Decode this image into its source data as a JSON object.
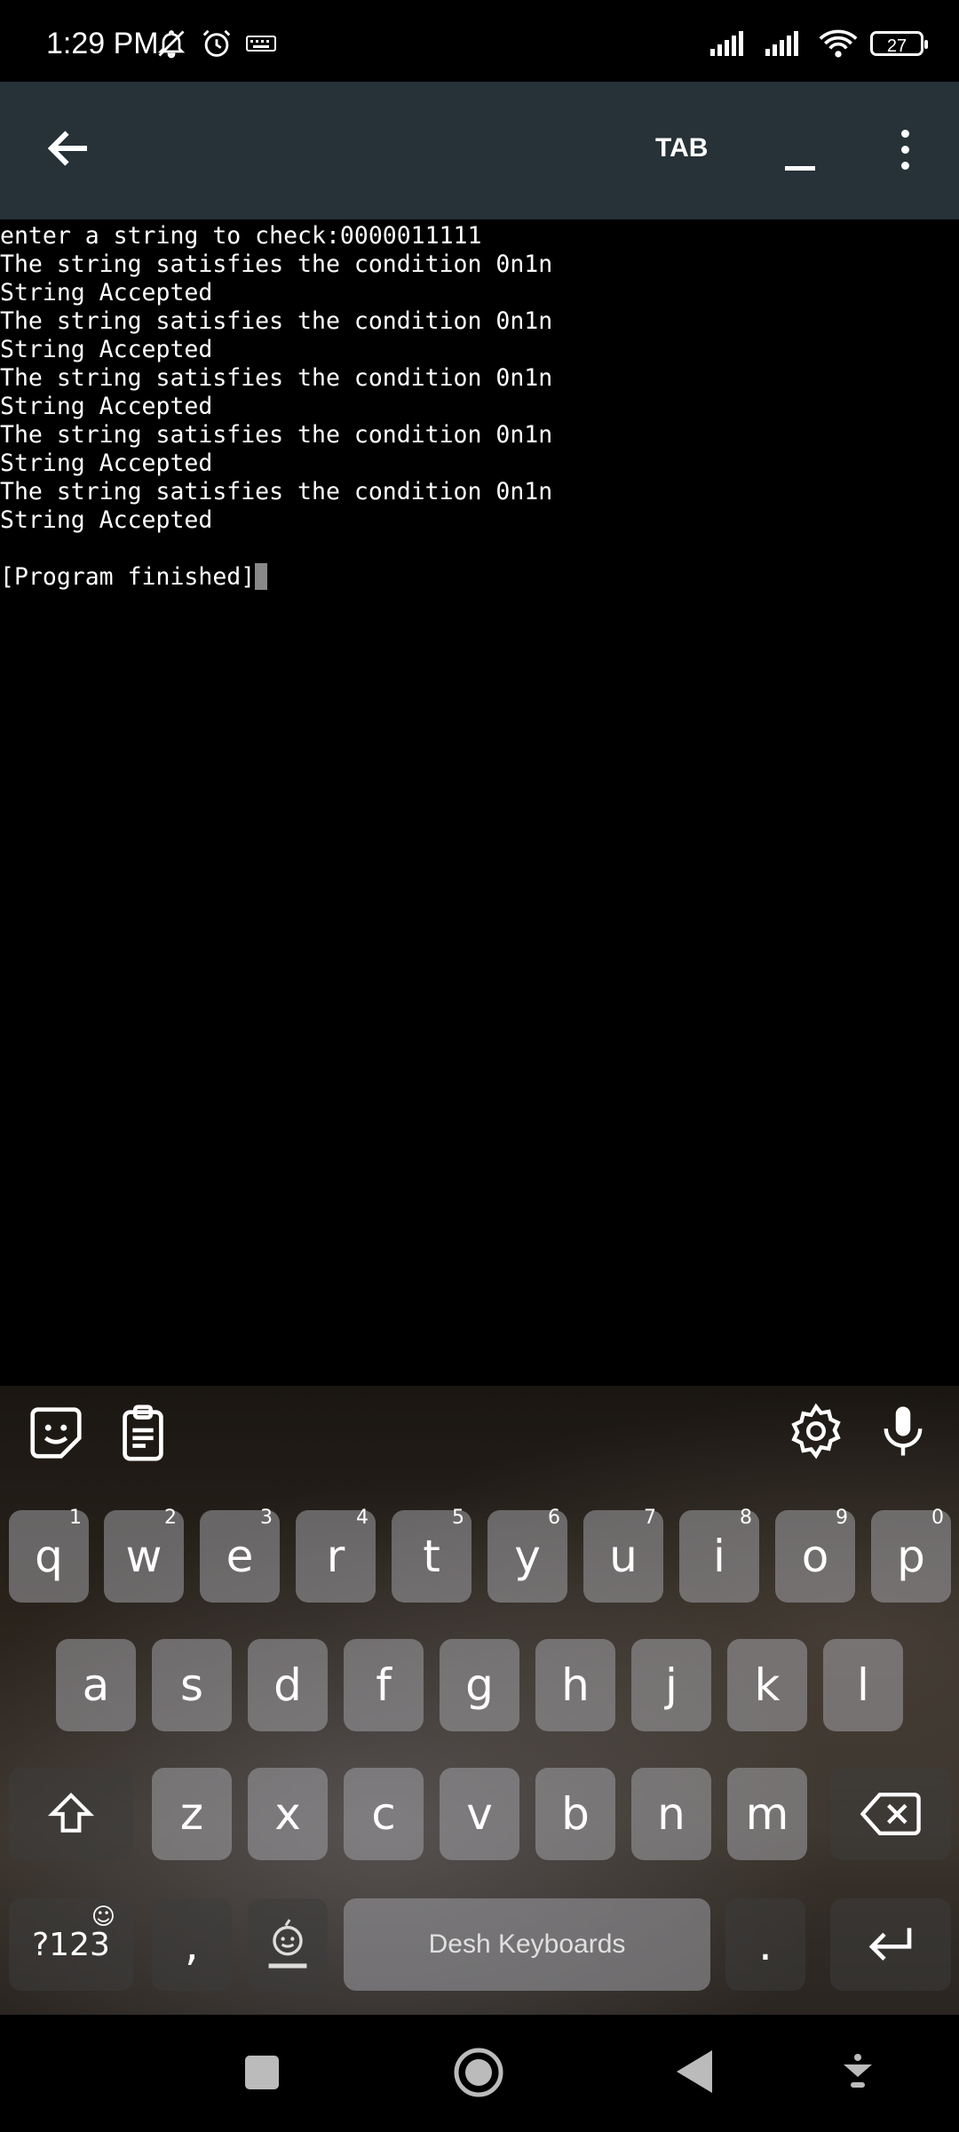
{
  "status_bar": {
    "time": "1:29 PM",
    "battery": "27",
    "icons": [
      "bell-off-icon",
      "alarm-icon",
      "keyboard-icon",
      "signal-icon",
      "signal-icon",
      "wifi-icon",
      "battery-icon"
    ]
  },
  "toolbar": {
    "tab_label": "TAB",
    "icons": [
      "back-arrow-icon",
      "minimize-icon",
      "more-vert-icon"
    ]
  },
  "terminal": {
    "lines": [
      "enter a string to check:0000011111",
      "The string satisfies the condition 0n1n",
      "String Accepted",
      "The string satisfies the condition 0n1n",
      "String Accepted",
      "The string satisfies the condition 0n1n",
      "String Accepted",
      "The string satisfies the condition 0n1n",
      "String Accepted",
      "The string satisfies the condition 0n1n",
      "String Accepted",
      "",
      "[Program finished]"
    ]
  },
  "keyboard": {
    "row1": [
      "q",
      "w",
      "e",
      "r",
      "t",
      "y",
      "u",
      "i",
      "o",
      "p"
    ],
    "row1_hints": [
      "1",
      "2",
      "3",
      "4",
      "5",
      "6",
      "7",
      "8",
      "9",
      "0"
    ],
    "row2": [
      "a",
      "s",
      "d",
      "f",
      "g",
      "h",
      "j",
      "k",
      "l"
    ],
    "row3": [
      "z",
      "x",
      "c",
      "v",
      "b",
      "n",
      "m"
    ],
    "symbols_key": "?123",
    "comma_key": ",",
    "period_key": ".",
    "space_label": "Desh Keyboards",
    "toolbar_icons": [
      "sticker-icon",
      "clipboard-icon",
      "settings-icon",
      "mic-icon"
    ]
  },
  "nav_bar": {
    "icons": [
      "recents-square-icon",
      "home-circle-icon",
      "back-triangle-icon",
      "hide-keyboard-icon"
    ]
  }
}
